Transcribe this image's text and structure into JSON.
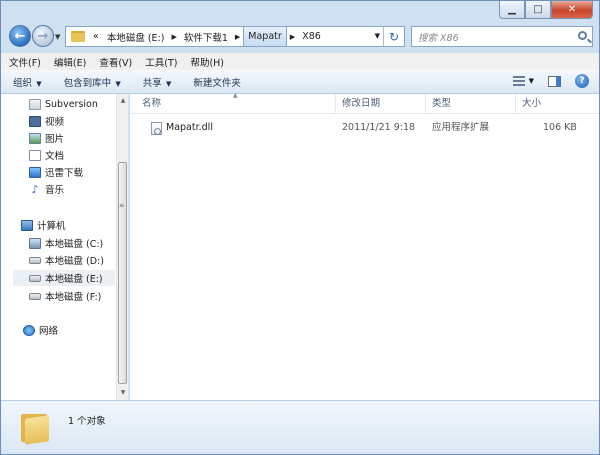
{
  "window": {
    "minimize_icon": "minimize-icon",
    "maximize_icon": "maximize-icon",
    "close_icon": "close-icon"
  },
  "address": {
    "overflow": "«",
    "crumbs": [
      "本地磁盘 (E:)",
      "软件下载1",
      "Mapatr",
      "X86"
    ],
    "search_placeholder": "搜索 X86"
  },
  "menu": [
    "文件(F)",
    "编辑(E)",
    "查看(V)",
    "工具(T)",
    "帮助(H)"
  ],
  "commands": {
    "organize": "组织",
    "include": "包含到库中",
    "share": "共享",
    "new_folder": "新建文件夹"
  },
  "nav": {
    "favorites": [
      "Subversion",
      "视频",
      "图片",
      "文档",
      "迅雷下载",
      "音乐"
    ],
    "computer": "计算机",
    "drives": [
      "本地磁盘 (C:)",
      "本地磁盘 (D:)",
      "本地磁盘 (E:)",
      "本地磁盘 (F:)"
    ],
    "selected_drive": "本地磁盘 (E:)",
    "network": "网络"
  },
  "columns": {
    "name": "名称",
    "date": "修改日期",
    "type": "类型",
    "size": "大小"
  },
  "files": [
    {
      "name": "Mapatr.dll",
      "date": "2011/1/21 9:18",
      "type": "应用程序扩展",
      "size": "106 KB"
    }
  ],
  "details": {
    "count": "1 个对象"
  }
}
